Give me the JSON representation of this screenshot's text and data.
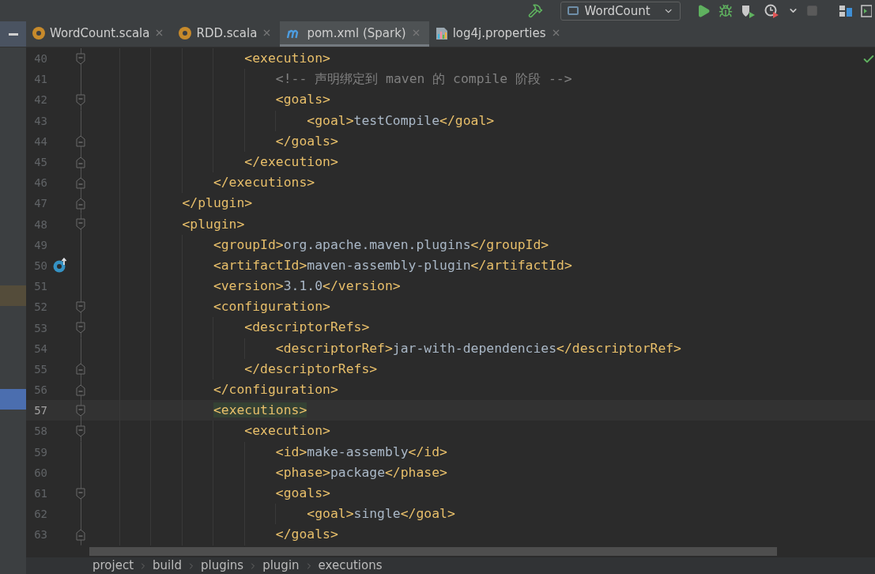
{
  "toolbar": {
    "run_config": "WordCount"
  },
  "tabs": [
    {
      "label": "WordCount.scala",
      "kind": "scala",
      "selected": false
    },
    {
      "label": "RDD.scala",
      "kind": "scala",
      "selected": false
    },
    {
      "label": "pom.xml (Spark)",
      "kind": "maven",
      "selected": true
    },
    {
      "label": "log4j.properties",
      "kind": "properties",
      "selected": false
    }
  ],
  "editor": {
    "lines": [
      {
        "number": "40",
        "fold_start": true,
        "fold_end": false,
        "gutter_icon": false,
        "current": false,
        "segments": [
          {
            "kind": "tag",
            "text": "                    <execution>"
          }
        ]
      },
      {
        "number": "41",
        "fold_start": false,
        "fold_end": false,
        "gutter_icon": false,
        "current": false,
        "segments": [
          {
            "kind": "comment",
            "text": "                        <!-- 声明绑定到 maven 的 compile 阶段 -->"
          }
        ]
      },
      {
        "number": "42",
        "fold_start": true,
        "fold_end": false,
        "gutter_icon": false,
        "current": false,
        "segments": [
          {
            "kind": "tag",
            "text": "                        <goals>"
          }
        ]
      },
      {
        "number": "43",
        "fold_start": false,
        "fold_end": false,
        "gutter_icon": false,
        "current": false,
        "segments": [
          {
            "kind": "tag",
            "text": "                            <goal>"
          },
          {
            "kind": "value",
            "text": "testCompile"
          },
          {
            "kind": "tag",
            "text": "</goal>"
          }
        ]
      },
      {
        "number": "44",
        "fold_start": false,
        "fold_end": true,
        "gutter_icon": false,
        "current": false,
        "segments": [
          {
            "kind": "tag",
            "text": "                        </goals>"
          }
        ]
      },
      {
        "number": "45",
        "fold_start": false,
        "fold_end": true,
        "gutter_icon": false,
        "current": false,
        "segments": [
          {
            "kind": "tag",
            "text": "                    </execution>"
          }
        ]
      },
      {
        "number": "46",
        "fold_start": false,
        "fold_end": true,
        "gutter_icon": false,
        "current": false,
        "segments": [
          {
            "kind": "tag",
            "text": "                </executions>"
          }
        ]
      },
      {
        "number": "47",
        "fold_start": false,
        "fold_end": true,
        "gutter_icon": false,
        "current": false,
        "segments": [
          {
            "kind": "tag",
            "text": "            </plugin>"
          }
        ]
      },
      {
        "number": "48",
        "fold_start": true,
        "fold_end": false,
        "gutter_icon": false,
        "current": false,
        "segments": [
          {
            "kind": "tag",
            "text": "            <plugin>"
          }
        ]
      },
      {
        "number": "49",
        "fold_start": false,
        "fold_end": false,
        "gutter_icon": false,
        "current": false,
        "segments": [
          {
            "kind": "tag",
            "text": "                <groupId>"
          },
          {
            "kind": "value",
            "text": "org.apache.maven.plugins"
          },
          {
            "kind": "tag",
            "text": "</groupId>"
          }
        ]
      },
      {
        "number": "50",
        "fold_start": false,
        "fold_end": false,
        "gutter_icon": true,
        "current": false,
        "segments": [
          {
            "kind": "tag",
            "text": "                <artifactId>"
          },
          {
            "kind": "value",
            "text": "maven-assembly-plugin"
          },
          {
            "kind": "tag",
            "text": "</artifactId>"
          }
        ]
      },
      {
        "number": "51",
        "fold_start": false,
        "fold_end": false,
        "gutter_icon": false,
        "current": false,
        "color": "#544c3a",
        "segments": [
          {
            "kind": "tag",
            "text": "                <version>"
          },
          {
            "kind": "value",
            "text": "3.1.0"
          },
          {
            "kind": "tag",
            "text": "</version>"
          }
        ]
      },
      {
        "number": "52",
        "fold_start": true,
        "fold_end": false,
        "gutter_icon": false,
        "current": false,
        "segments": [
          {
            "kind": "tag",
            "text": "                <configuration>"
          }
        ]
      },
      {
        "number": "53",
        "fold_start": true,
        "fold_end": false,
        "gutter_icon": false,
        "current": false,
        "segments": [
          {
            "kind": "tag",
            "text": "                    <descriptorRefs>"
          }
        ]
      },
      {
        "number": "54",
        "fold_start": false,
        "fold_end": false,
        "gutter_icon": false,
        "current": false,
        "segments": [
          {
            "kind": "tag",
            "text": "                        <descriptorRef>"
          },
          {
            "kind": "value",
            "text": "jar-with-dependencies"
          },
          {
            "kind": "tag",
            "text": "</descriptorRef>"
          }
        ]
      },
      {
        "number": "55",
        "fold_start": false,
        "fold_end": true,
        "gutter_icon": false,
        "current": false,
        "segments": [
          {
            "kind": "tag",
            "text": "                    </descriptorRefs>"
          }
        ]
      },
      {
        "number": "56",
        "fold_start": false,
        "fold_end": true,
        "gutter_icon": false,
        "current": false,
        "color": "#4b6eaf",
        "segments": [
          {
            "kind": "tag",
            "text": "                </configuration>"
          }
        ]
      },
      {
        "number": "57",
        "fold_start": true,
        "fold_end": false,
        "gutter_icon": false,
        "current": true,
        "segments": [
          {
            "kind": "tag",
            "text": "                <executions>"
          }
        ]
      },
      {
        "number": "58",
        "fold_start": true,
        "fold_end": false,
        "gutter_icon": false,
        "current": false,
        "segments": [
          {
            "kind": "tag",
            "text": "                    <execution>"
          }
        ]
      },
      {
        "number": "59",
        "fold_start": false,
        "fold_end": false,
        "gutter_icon": false,
        "current": false,
        "segments": [
          {
            "kind": "tag",
            "text": "                        <id>"
          },
          {
            "kind": "value",
            "text": "make-assembly"
          },
          {
            "kind": "tag",
            "text": "</id>"
          }
        ]
      },
      {
        "number": "60",
        "fold_start": false,
        "fold_end": false,
        "gutter_icon": false,
        "current": false,
        "segments": [
          {
            "kind": "tag",
            "text": "                        <phase>"
          },
          {
            "kind": "value",
            "text": "package"
          },
          {
            "kind": "tag",
            "text": "</phase>"
          }
        ]
      },
      {
        "number": "61",
        "fold_start": true,
        "fold_end": false,
        "gutter_icon": false,
        "current": false,
        "segments": [
          {
            "kind": "tag",
            "text": "                        <goals>"
          }
        ]
      },
      {
        "number": "62",
        "fold_start": false,
        "fold_end": false,
        "gutter_icon": false,
        "current": false,
        "segments": [
          {
            "kind": "tag",
            "text": "                            <goal>"
          },
          {
            "kind": "value",
            "text": "single"
          },
          {
            "kind": "tag",
            "text": "</goal>"
          }
        ]
      },
      {
        "number": "63",
        "fold_start": false,
        "fold_end": true,
        "gutter_icon": false,
        "current": false,
        "segments": [
          {
            "kind": "tag",
            "text": "                        </goals>"
          }
        ]
      }
    ]
  },
  "breadcrumbs": [
    "project",
    "build",
    "plugins",
    "plugin",
    "executions"
  ]
}
